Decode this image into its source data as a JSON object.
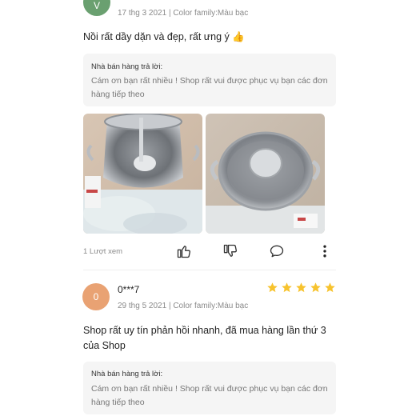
{
  "reviews": [
    {
      "avatar_letter": "V",
      "avatar_color": "#6aa070",
      "date_meta": "17 thg 3 2021 | Color family:Màu bạc",
      "text": "Nồi rất dầy dặn và đẹp, rất ưng ý 👍",
      "seller_reply_label": "Nhà bán hàng trả lời:",
      "seller_reply": "Cám ơn bạn rất nhiều ! Shop rất vui được phục vụ bạn các đơn hàng tiếp theo",
      "views": "1 Lượt xem"
    },
    {
      "avatar_letter": "0",
      "avatar_color": "#e9a273",
      "user": "0***7",
      "rating": 5,
      "date_meta": "29 thg 5 2021 | Color family:Màu bạc",
      "text": "Shop rất uy tín  phản hồi nhanh,  đã mua hàng lần thứ 3 của Shop",
      "seller_reply_label": "Nhà bán hàng trả lời:",
      "seller_reply": "Cám ơn bạn rất nhiều ! Shop rất vui được phục vụ bạn các đơn hàng tiếp theo"
    }
  ],
  "colors": {
    "star": "#f7c32e",
    "icon": "#333333"
  },
  "icons": [
    "thumbs-up-icon",
    "thumbs-down-icon",
    "comment-icon",
    "more-vertical-icon",
    "star-icon"
  ]
}
